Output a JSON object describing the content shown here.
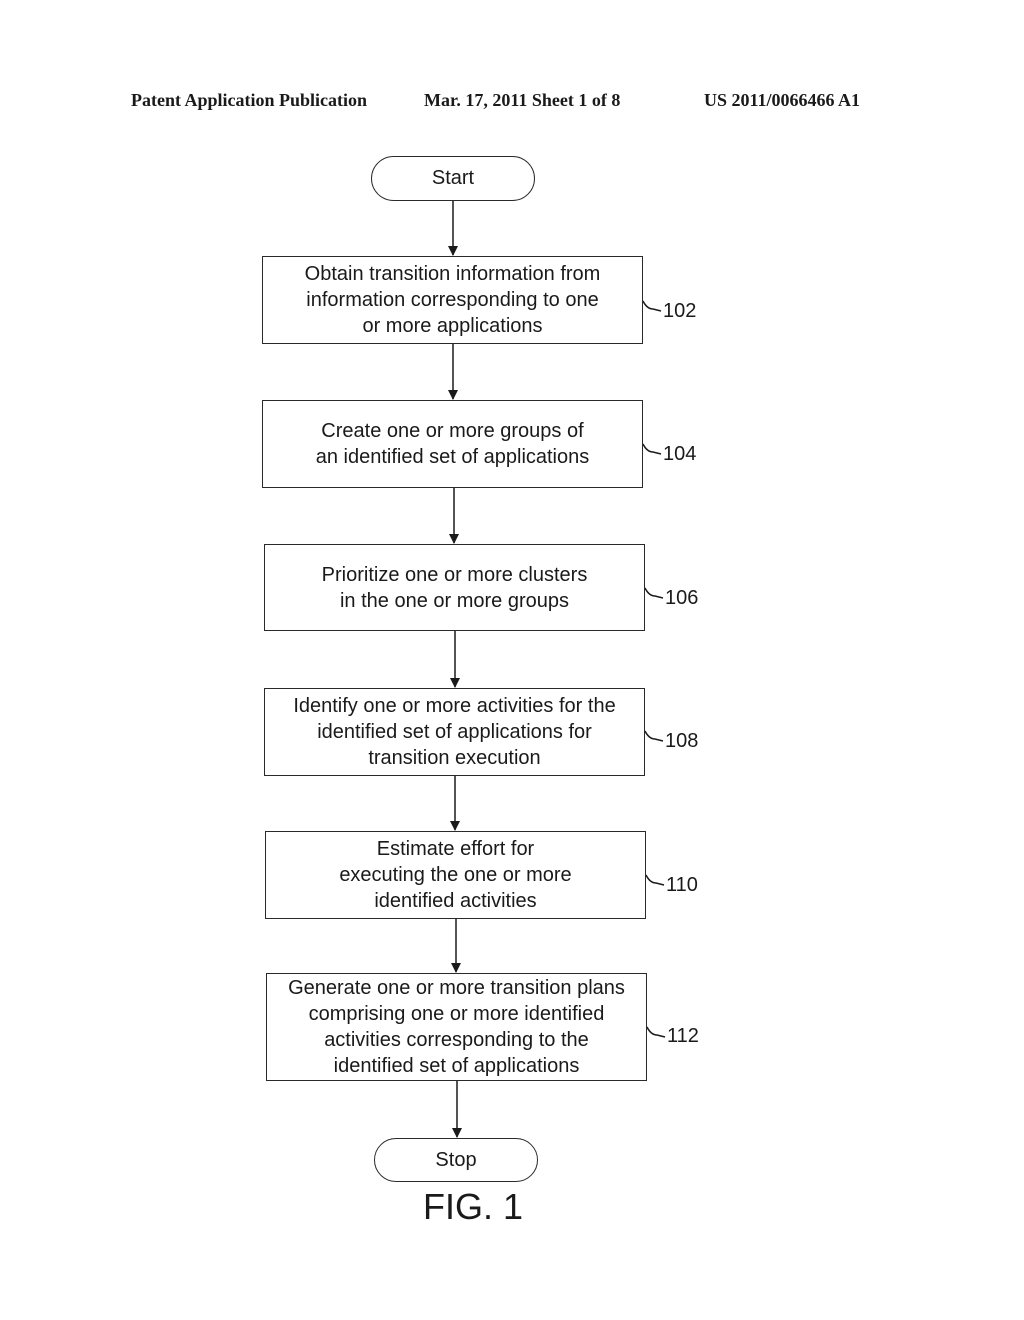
{
  "header": {
    "left": "Patent Application Publication",
    "middle": "Mar. 17, 2011  Sheet 1 of 8",
    "right": "US 2011/0066466 A1"
  },
  "flowchart": {
    "start": "Start",
    "stop": "Stop",
    "steps": [
      {
        "ref": "102",
        "lines": [
          "Obtain transition information from",
          "information corresponding to one",
          "or more applications"
        ]
      },
      {
        "ref": "104",
        "lines": [
          "Create one or more groups of",
          "an identified set of applications"
        ]
      },
      {
        "ref": "106",
        "lines": [
          "Prioritize one or more clusters",
          "in the one or more groups"
        ]
      },
      {
        "ref": "108",
        "lines": [
          "Identify one or more activities for the",
          "identified set of applications for",
          "transition execution"
        ]
      },
      {
        "ref": "110",
        "lines": [
          "Estimate effort for",
          "executing the one or more",
          "identified activities"
        ]
      },
      {
        "ref": "112",
        "lines": [
          "Generate one or more transition plans",
          "comprising one or more identified",
          "activities corresponding to the",
          "identified set of applications"
        ]
      }
    ]
  },
  "figure_label": "FIG. 1"
}
